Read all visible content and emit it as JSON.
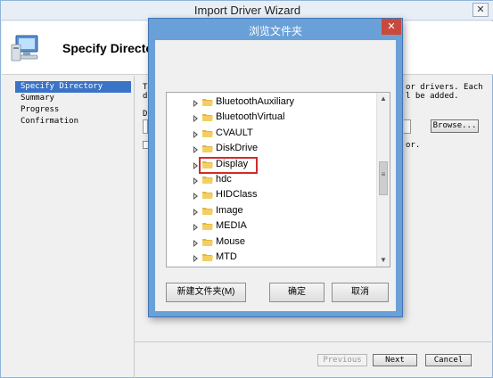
{
  "wizard": {
    "title": "Import Driver Wizard",
    "close_glyph": "✕",
    "header_title": "Specify Directory",
    "icon": "computer-icon",
    "nav": [
      {
        "label": "Specify Directory",
        "active": true
      },
      {
        "label": "Summary",
        "active": false
      },
      {
        "label": "Progress",
        "active": false
      },
      {
        "label": "Confirmation",
        "active": false
      }
    ],
    "fragments": {
      "line1_left": "T",
      "line1_right": "or drivers.  Each",
      "line2_left": "d",
      "line2_right": "l be added.",
      "label_left": "D",
      "check_right": "or."
    },
    "browse_label": "Browse...",
    "buttons": {
      "previous": "Previous",
      "next": "Next",
      "cancel": "Cancel"
    }
  },
  "dialog": {
    "title": "浏览文件夹",
    "close_glyph": "✕",
    "folders": [
      {
        "name": "BluetoothAuxiliary",
        "highlight": false
      },
      {
        "name": "BluetoothVirtual",
        "highlight": false
      },
      {
        "name": "CVAULT",
        "highlight": false
      },
      {
        "name": "DiskDrive",
        "highlight": false
      },
      {
        "name": "Display",
        "highlight": true
      },
      {
        "name": "hdc",
        "highlight": false
      },
      {
        "name": "HIDClass",
        "highlight": false
      },
      {
        "name": "Image",
        "highlight": false
      },
      {
        "name": "MEDIA",
        "highlight": false
      },
      {
        "name": "Mouse",
        "highlight": false
      },
      {
        "name": "MTD",
        "highlight": false
      }
    ],
    "buttons": {
      "new_folder": "新建文件夹(M)",
      "ok": "确定",
      "cancel": "取消"
    },
    "scroll_up_glyph": "▲",
    "scroll_down_glyph": "▼",
    "scroll_grip": "≡"
  }
}
